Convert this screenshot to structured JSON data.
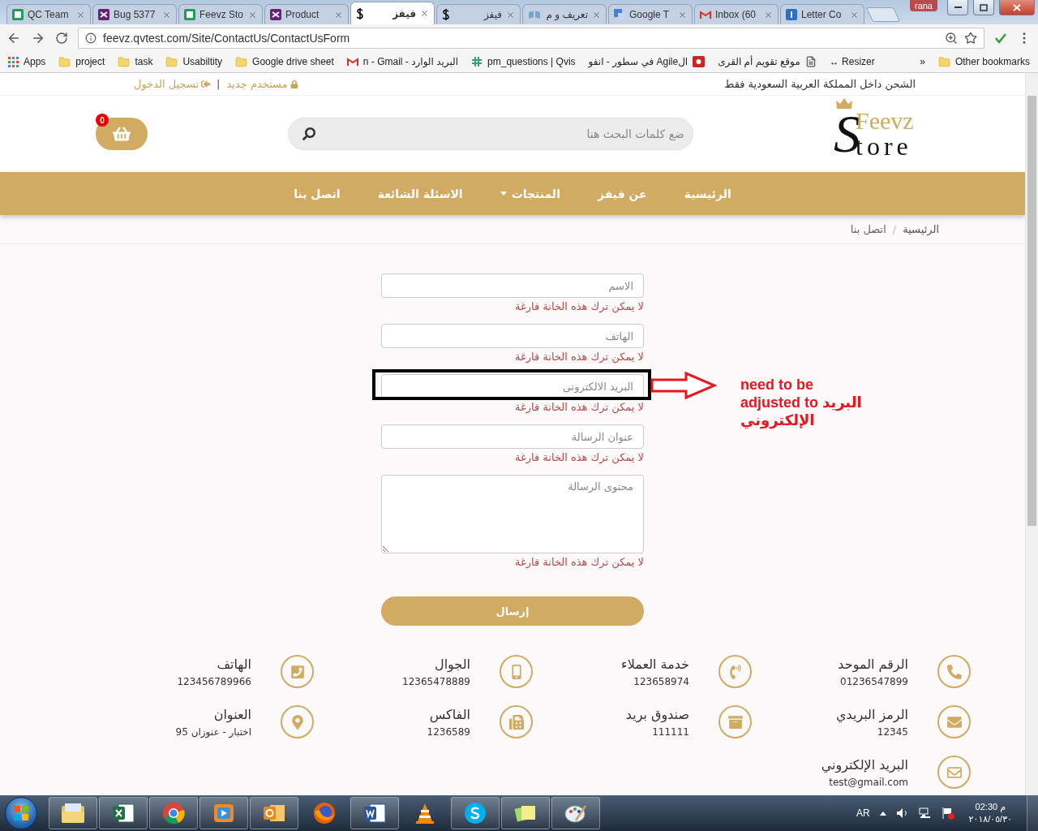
{
  "browser": {
    "tabs": [
      {
        "kind": "doc",
        "title": "Letter Co",
        "selected": false
      },
      {
        "kind": "gmail",
        "title": "Inbox (60",
        "selected": false
      },
      {
        "kind": "translate",
        "title": "Google T",
        "selected": false
      },
      {
        "kind": "book",
        "title": "تعريف و م",
        "selected": false
      },
      {
        "kind": "dollar",
        "title": "فيفز",
        "selected": false
      },
      {
        "kind": "dollar",
        "title": "فيفز",
        "selected": true
      },
      {
        "kind": "vs",
        "title": "Product",
        "selected": false
      },
      {
        "kind": "sheet",
        "title": "Feevz Sto",
        "selected": false
      },
      {
        "kind": "vs",
        "title": "Bug 5377",
        "selected": false
      },
      {
        "kind": "sheet",
        "title": "QC Team",
        "selected": false
      }
    ],
    "profile": "rana",
    "address": "feevz.qvtest.com/Site/ContactUs/ContactUsForm",
    "bookmarks": [
      {
        "kind": "folder",
        "label": "Other bookmarks"
      },
      {
        "kind": "overflow",
        "label": "»"
      },
      {
        "kind": "plain",
        "label": "↔ Resizer"
      },
      {
        "kind": "page",
        "label": "موقع تقويم أم القرى"
      },
      {
        "kind": "badge",
        "label": "الAgile في سطور - انفو"
      },
      {
        "kind": "slack",
        "label": "pm_questions | Qvis"
      },
      {
        "kind": "gmail",
        "label": "n - Gmail - البريد الوارد"
      },
      {
        "kind": "folder",
        "label": "Google drive sheet"
      },
      {
        "kind": "folder",
        "label": "Usabiltity"
      },
      {
        "kind": "folder",
        "label": "task"
      },
      {
        "kind": "folder",
        "label": "project"
      },
      {
        "kind": "apps",
        "label": "Apps"
      }
    ]
  },
  "top_bar": {
    "shipping_note": "الشحن داخل المملكة العربية السعودية فقط",
    "account_links": [
      {
        "kind": "register",
        "label": "مستخدم جديد"
      },
      {
        "kind": "login",
        "label": "تسجيل الدخول"
      }
    ],
    "separator": "|"
  },
  "header": {
    "logo": {
      "initial": "S",
      "line_1": "Feevz",
      "line_2": "tore"
    },
    "search": {
      "placeholder": "ضع كلمات البحث هنا"
    },
    "cart": {
      "count": "0"
    }
  },
  "nav": [
    {
      "label": "الرئيسية",
      "dropdown": false
    },
    {
      "label": "عن فيفز",
      "dropdown": false
    },
    {
      "label": "المنتجات",
      "dropdown": true
    },
    {
      "label": "الاسئلة الشائعة",
      "dropdown": false
    },
    {
      "label": "اتصل بنا",
      "dropdown": false
    }
  ],
  "breadcrumb": {
    "items": [
      "الرئيسية",
      "اتصل بنا"
    ],
    "separator": "/"
  },
  "form": {
    "fields": [
      {
        "kind": "input",
        "placeholder": "الاسم",
        "error": "لا يمكن ترك هذه الخانة فارغة",
        "annotated": false
      },
      {
        "kind": "input",
        "placeholder": "الهاتف",
        "error": "لا يمكن ترك هذه الخانة فارغة",
        "annotated": false
      },
      {
        "kind": "input",
        "placeholder": "البريد الالكترونى",
        "error": "لا يمكن ترك هذه الخانة فارغة",
        "annotated": true
      },
      {
        "kind": "input",
        "placeholder": "عنوان الرسالة",
        "error": "لا يمكن ترك هذه الخانة فارغة",
        "annotated": false
      },
      {
        "kind": "textarea",
        "placeholder": "محتوى الرسالة",
        "error": "لا يمكن ترك هذه الخانة فارغة",
        "annotated": false
      }
    ],
    "submit": "إرسال"
  },
  "annotation": {
    "note": "need to be adjusted to البريد الإلكتروني"
  },
  "contacts": [
    {
      "kind": "phone",
      "title": "الرقم الموحد",
      "value": "01236547899"
    },
    {
      "kind": "phone_ring",
      "title": "خدمة العملاء",
      "value": "123658974"
    },
    {
      "kind": "mobile",
      "title": "الجوال",
      "value": "12365478889"
    },
    {
      "kind": "phone_square",
      "title": "الهاتف",
      "value": "123456789966"
    },
    {
      "kind": "envelope",
      "title": "الرمز البريدي",
      "value": "12345"
    },
    {
      "kind": "archive",
      "title": "صندوق بريد",
      "value": "111111"
    },
    {
      "kind": "fax",
      "title": "الفاكس",
      "value": "1236589"
    },
    {
      "kind": "pin",
      "title": "العنوان",
      "value": "اختبار - عنوزان 95"
    },
    {
      "kind": "envelope_outline",
      "title": "البريد الإلكتروني",
      "value": "test@gmail.com"
    }
  ],
  "taskbar": {
    "apps": [
      {
        "kind": "explorer",
        "running": true
      },
      {
        "kind": "excel",
        "running": true
      },
      {
        "kind": "chrome",
        "running": true
      },
      {
        "kind": "media",
        "running": true
      },
      {
        "kind": "outlook",
        "running": true
      },
      {
        "kind": "firefox",
        "running": false
      },
      {
        "kind": "word",
        "running": true
      },
      {
        "kind": "vlc",
        "running": false
      },
      {
        "kind": "skype",
        "running": true
      },
      {
        "kind": "notes",
        "running": true
      },
      {
        "kind": "paint",
        "running": true
      }
    ],
    "language": "AR",
    "time": "02:30 م",
    "date": "٢٠١٨/٠٥/٣٠"
  }
}
